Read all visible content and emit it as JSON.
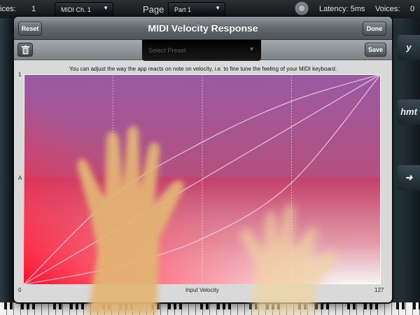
{
  "background": {
    "voices_label_left": "ices:",
    "voices_value_left": "1",
    "channel_value": "MIDI Ch. 1",
    "page_label": "Page",
    "part_value": "Part 1",
    "latency": "Latency: 5ms",
    "voices_status": "Voices:",
    "voices_status_value": "0",
    "side_buttons": [
      "y",
      "hmt",
      "➜"
    ]
  },
  "dialog": {
    "title": "MIDI Velocity Response",
    "reset_label": "Reset",
    "done_label": "Done",
    "save_label": "Save",
    "preset_placeholder": "Select Preset",
    "hint": "You can adjust the way the app reacts on note on velocity, i.e. to fine tune the feeling of your MIDI keyboard.",
    "y_labels": [
      "1",
      "A",
      "0"
    ],
    "x_axis_label": "Input Velocity",
    "x_max_label": "127"
  },
  "chart_data": {
    "type": "line",
    "xlabel": "Input Velocity",
    "ylabel": "",
    "xlim": [
      0,
      127
    ],
    "ylim": [
      0,
      1
    ],
    "x_tick_labels": [
      "0",
      "127"
    ],
    "y_tick_labels": [
      "0",
      "A",
      "1"
    ],
    "grid": "vertical dashed lines at quarters",
    "series": [
      {
        "x": [
          0,
          32,
          64,
          95,
          127
        ],
        "values": [
          0,
          0.42,
          0.68,
          0.87,
          1
        ]
      },
      {
        "x": [
          0,
          127
        ],
        "values": [
          0,
          1
        ]
      },
      {
        "x": [
          0,
          32,
          64,
          95,
          127
        ],
        "values": [
          0,
          0.08,
          0.22,
          0.48,
          1
        ]
      }
    ],
    "colors": {
      "gradient_top": "#9a5aa4",
      "gradient_mid": "#c83a72",
      "gradient_low": "#ff1a35",
      "curve": "#f2d6ee"
    }
  }
}
